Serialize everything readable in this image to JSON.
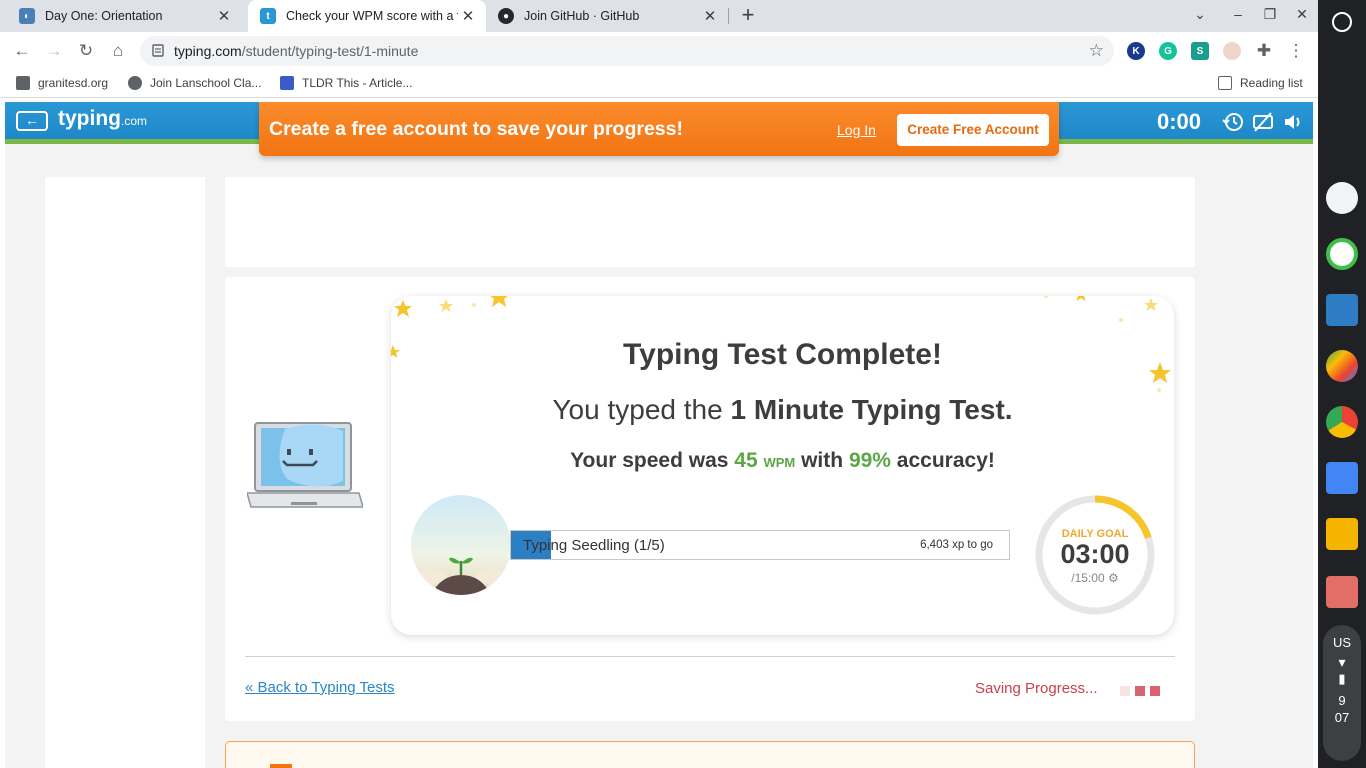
{
  "browser": {
    "tabs": [
      {
        "title": "Day One: Orientation",
        "active": false
      },
      {
        "title": "Check your WPM score with a fre",
        "active": true
      },
      {
        "title": "Join GitHub · GitHub",
        "active": false
      }
    ],
    "url_host": "typing.com",
    "url_path": "/student/typing-test/1-minute",
    "bookmarks": [
      "granitesd.org",
      "Join Lanschool Cla...",
      "TLDR This - Article..."
    ],
    "reading_list": "Reading list",
    "extensions": [
      "K",
      "G",
      "S"
    ]
  },
  "site": {
    "logo": "typing",
    "logo_suffix": ".com",
    "timer": "0:00"
  },
  "banner": {
    "text": "Create a free account to save your progress!",
    "login": "Log In",
    "create": "Create Free Account"
  },
  "result": {
    "title": "Typing Test Complete!",
    "typed_prefix": "You typed the ",
    "test_name": "1 Minute Typing Test.",
    "speed_prefix": "Your speed was ",
    "wpm": "45",
    "wpm_unit": "WPM",
    "with": " with ",
    "accuracy": "99%",
    "accuracy_suffix": " accuracy!"
  },
  "level": {
    "name": "Typing Seedling (1/5)",
    "xp_to_go": "6,403 xp to go",
    "progress_fraction": 0.08
  },
  "goal": {
    "label": "DAILY GOAL",
    "time": "03:00",
    "total": "/15:00",
    "progress_fraction": 0.2
  },
  "footer": {
    "back_link": "« Back to Typing Tests",
    "saving": "Saving Progress..."
  },
  "system": {
    "locale": "US",
    "time_hour": "9",
    "time_min": "07"
  },
  "colors": {
    "brand_blue": "#1d86c6",
    "banner_orange": "#f27413",
    "accent_green": "#5ca745",
    "saving_red": "#c8414d"
  }
}
